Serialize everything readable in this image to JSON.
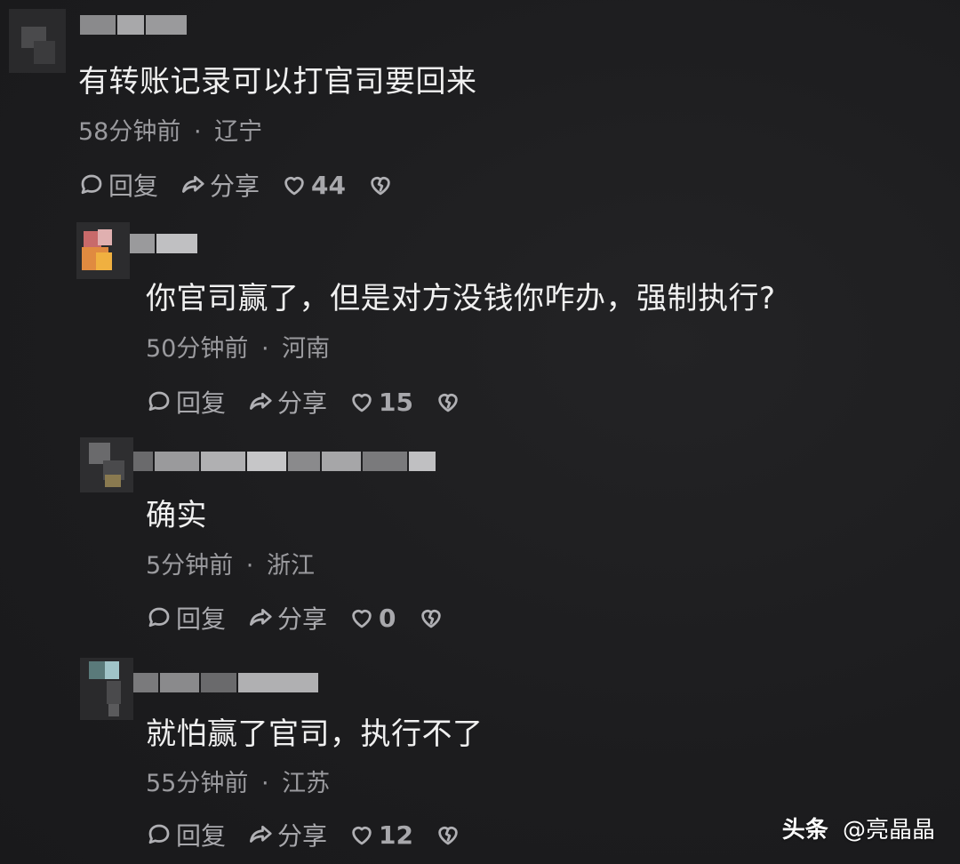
{
  "comments": [
    {
      "text": "有转账记录可以打官司要回来",
      "time": "58分钟前",
      "sep": "·",
      "location": "辽宁",
      "reply_label": "回复",
      "share_label": "分享",
      "likes": "44"
    },
    {
      "text": "你官司赢了，但是对方没钱你咋办，强制执行?",
      "time": "50分钟前",
      "sep": "·",
      "location": "河南",
      "reply_label": "回复",
      "share_label": "分享",
      "likes": "15"
    },
    {
      "text": "确实",
      "time": "5分钟前",
      "sep": "·",
      "location": "浙江",
      "reply_label": "回复",
      "share_label": "分享",
      "likes": "0"
    },
    {
      "text": "就怕赢了官司，执行不了",
      "time": "55分钟前",
      "sep": "·",
      "location": "江苏",
      "reply_label": "回复",
      "share_label": "分享",
      "likes": "12"
    }
  ],
  "watermark": {
    "brand": "头条",
    "author": "@亮晶晶"
  },
  "colors": {
    "background": "#1c1c1e",
    "text": "#f0f0f0",
    "meta": "#9a9a9e"
  }
}
